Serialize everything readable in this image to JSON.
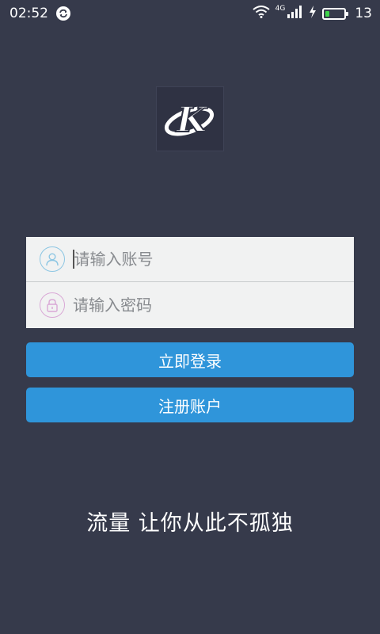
{
  "status_bar": {
    "time": "02:52",
    "network": "4G",
    "battery": "13",
    "battery_level": 0.2,
    "battery_color": "#3fd34b"
  },
  "logo": {
    "letter": "K"
  },
  "login_form": {
    "account_placeholder": "请输入账号",
    "password_placeholder": "请输入密码"
  },
  "buttons": {
    "login_label": "立即登录",
    "register_label": "注册账户"
  },
  "slogan": "流量 让你从此不孤独",
  "colors": {
    "background": "#363a4b",
    "button": "#2f95da",
    "card": "#f1f2f2"
  }
}
